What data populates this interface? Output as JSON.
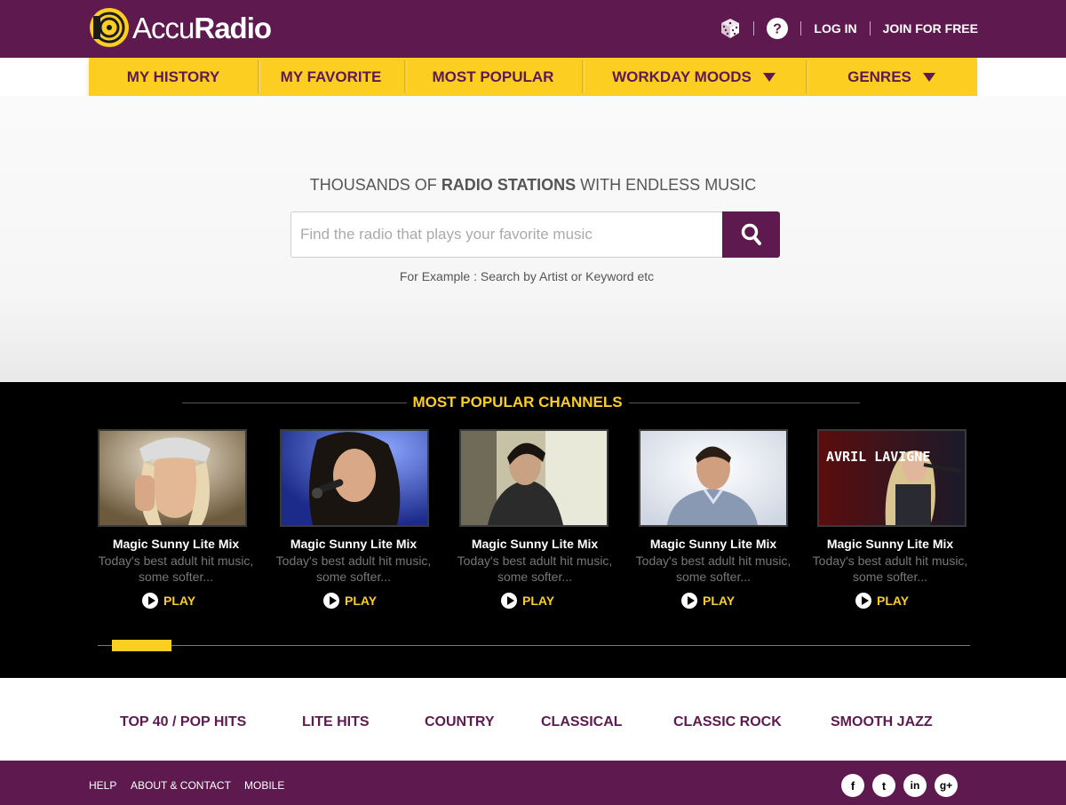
{
  "brand": {
    "name_light": "Accu",
    "name_bold": "Radio"
  },
  "topnav": {
    "login": "LOG IN",
    "join": "JOIN FOR FREE"
  },
  "mainnav": [
    {
      "label": "MY HISTORY",
      "dropdown": false
    },
    {
      "label": "MY FAVORITE",
      "dropdown": false
    },
    {
      "label": "MOST POPULAR",
      "dropdown": false
    },
    {
      "label": "WORKDAY MOODS",
      "dropdown": true
    },
    {
      "label": "GENRES",
      "dropdown": true
    }
  ],
  "hero": {
    "tagline_pre": "THOUSANDS OF",
    "tagline_bold": "RADIO STATIONS",
    "tagline_post": "WITH ENDLESS MUSIC",
    "search_placeholder": "Find the radio that plays your favorite music",
    "search_value": "",
    "example": "For Example : Search by Artist or Keyword etc"
  },
  "popular": {
    "title": "MOST POPULAR CHANNELS",
    "channels": [
      {
        "title": "Magic Sunny Lite Mix",
        "desc": "Today's best adult hit music, some softer...",
        "play": "PLAY"
      },
      {
        "title": "Magic Sunny Lite Mix",
        "desc": "Today's best adult hit music, some softer...",
        "play": "PLAY"
      },
      {
        "title": "Magic Sunny Lite Mix",
        "desc": "Today's best adult hit music, some softer...",
        "play": "PLAY"
      },
      {
        "title": "Magic Sunny Lite Mix",
        "desc": "Today's best adult hit music, some softer...",
        "play": "PLAY"
      },
      {
        "title": "Magic Sunny Lite Mix",
        "desc": "Today's best adult hit music, some softer...",
        "play": "PLAY"
      }
    ],
    "thumb5_overlay": "AVRIL LAVIGNE"
  },
  "genres": [
    "TOP 40 / POP HITS",
    "LITE HITS",
    "COUNTRY",
    "CLASSICAL",
    "CLASSIC ROCK",
    "SMOOTH JAZZ"
  ],
  "footer": {
    "links": [
      "HELP",
      "ABOUT & CONTACT",
      "MOBILE"
    ],
    "social": [
      "f",
      "t",
      "in",
      "g+"
    ]
  },
  "colors": {
    "brand_purple": "#5e1a4e",
    "accent_yellow": "#fcce22",
    "black": "#000000"
  },
  "icons": [
    "dice-icon",
    "help-icon",
    "search-icon",
    "play-icon",
    "facebook-icon",
    "twitter-icon",
    "linkedin-icon",
    "google-plus-icon"
  ]
}
